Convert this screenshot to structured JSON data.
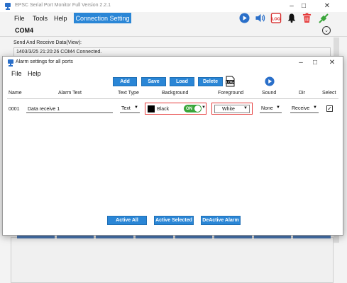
{
  "main": {
    "title": "EPSC Serial Port Monitor Full Version 2.2.1",
    "menu": [
      "File",
      "Tools",
      "Help"
    ],
    "connection_button": "Connection Setting",
    "com_label": "COM4",
    "send_receive_label": "Send And Receive Data(View):",
    "log_line": "1403/3/25 21:20:26 COM4 Connected.",
    "log_icon_text": "LOG"
  },
  "dialog": {
    "title": "Alarm settings for all ports",
    "menu": [
      "File",
      "Help"
    ],
    "buttons": {
      "add": "Add",
      "save": "Save",
      "load": "Load",
      "delete": "Delete"
    },
    "log_icon_text": "LOG",
    "columns": [
      "Name",
      "Alarm Text",
      "Text Type",
      "Background",
      "Foreground",
      "Sound",
      "Dir",
      "Select"
    ],
    "row": {
      "name": "0001",
      "alarm_text": "Data receive 1",
      "text_type": "Text",
      "background": "Black",
      "toggle": "ON",
      "foreground": "White",
      "sound": "None",
      "dir": "Receive",
      "selected": true
    },
    "bottom_buttons": {
      "active_all": "Active All",
      "active_selected": "Active Selected",
      "deactive_alarm": "DeActive Alarm"
    }
  },
  "colors": {
    "accent": "#2a86d6",
    "toggle_on": "#3aa53a",
    "highlight_frame": "#e53a3a",
    "delete_icon": "#e53a3a",
    "status_plug": "#3aa53a"
  }
}
